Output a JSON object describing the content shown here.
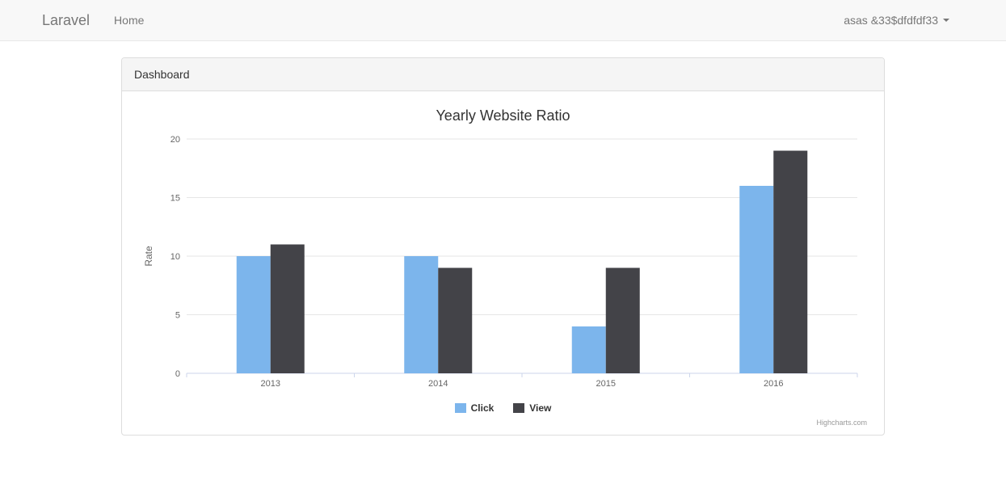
{
  "navbar": {
    "brand": "Laravel",
    "home": "Home",
    "user": "asas &33$dfdfdf33"
  },
  "panel": {
    "heading": "Dashboard"
  },
  "chart_data": {
    "type": "bar",
    "title": "Yearly Website Ratio",
    "ylabel": "Rate",
    "xlabel": "",
    "ylim": [
      0,
      20
    ],
    "yticks": [
      0,
      5,
      10,
      15,
      20
    ],
    "categories": [
      "2013",
      "2014",
      "2015",
      "2016"
    ],
    "series": [
      {
        "name": "Click",
        "values": [
          10,
          10,
          4,
          16
        ],
        "color": "#7cb5ec"
      },
      {
        "name": "View",
        "values": [
          11,
          9,
          9,
          19
        ],
        "color": "#434348"
      }
    ],
    "credits": "Highcharts.com"
  }
}
